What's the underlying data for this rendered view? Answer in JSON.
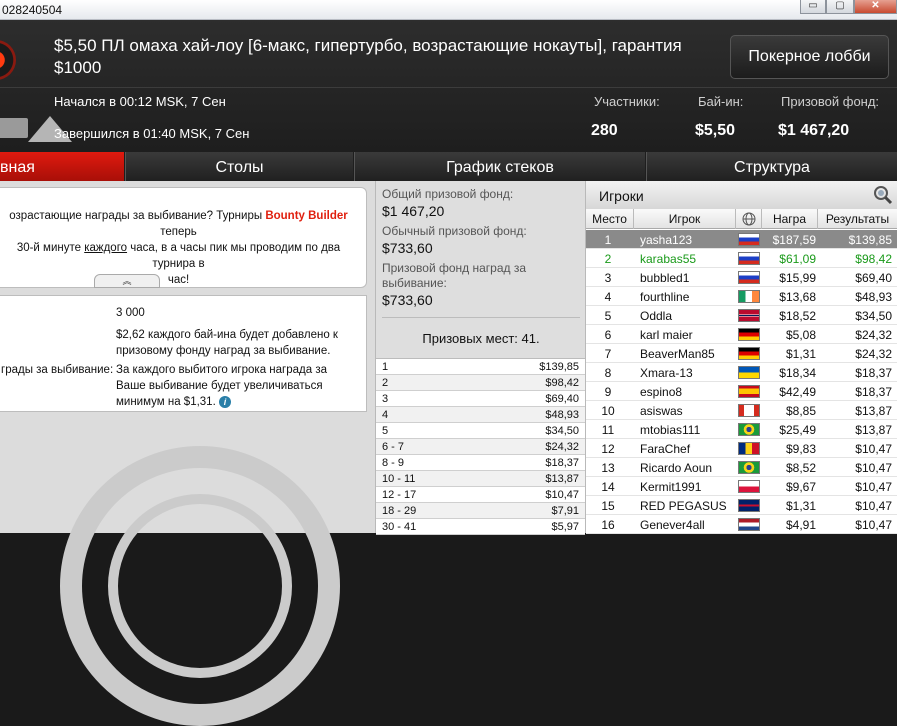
{
  "window": {
    "title_partial": "028240504",
    "btn_minimize": "▭",
    "btn_restore": "▢",
    "btn_close": "✕"
  },
  "header": {
    "title": "$5,50 ПЛ омаха хай-лоу [6-макс, гипертурбо, возрастающие нокауты], гарантия $1000",
    "lobby_button": "Покерное лобби",
    "started": "Начался в 00:12 MSK, 7 Сен",
    "finished": "Завершился в 01:40 MSK, 7 Сен",
    "stats": [
      {
        "label": "Участники:",
        "value": "280"
      },
      {
        "label": "Бай-ин:",
        "value": "$5,50"
      },
      {
        "label": "Призовой фонд:",
        "value": "$1 467,20"
      }
    ]
  },
  "tabs": [
    "вная",
    "Столы",
    "График стеков",
    "Структура"
  ],
  "notice": {
    "line1_a": "озрастающие награды за выбивание? Турниры ",
    "line1_bold": "Bounty Builder",
    "line1_b": " теперь",
    "line2_a": "30-й минуте ",
    "line2_u": "каждого",
    "line2_b": " часа, в а часы пик мы проводим по два турнира в",
    "line3": "час!",
    "collapse": "︽"
  },
  "details": {
    "starting_stack": "3 000",
    "bounty_info": "$2,62 каждого бай-ина будет добавлено к призовому фонду наград за выбивание.",
    "bounty_label": "грады за выбивание:",
    "bounty_desc": "За каждого выбитого игрока награда за Ваше выбивание будет увеличиваться минимум на $1,31."
  },
  "prize": {
    "total_label": "Общий призовой фонд:",
    "total_value": "$1 467,20",
    "regular_label": "Обычный призовой фонд:",
    "regular_value": "$733,60",
    "bounty_label": "Призовой фонд наград за выбивание:",
    "bounty_value": "$733,60",
    "places_text": "Призовых мест: 41.",
    "rows": [
      {
        "place": "1",
        "amount": "$139,85"
      },
      {
        "place": "2",
        "amount": "$98,42"
      },
      {
        "place": "3",
        "amount": "$69,40"
      },
      {
        "place": "4",
        "amount": "$48,93"
      },
      {
        "place": "5",
        "amount": "$34,50"
      },
      {
        "place": "6 - 7",
        "amount": "$24,32"
      },
      {
        "place": "8 - 9",
        "amount": "$18,37"
      },
      {
        "place": "10 - 11",
        "amount": "$13,87"
      },
      {
        "place": "12 - 17",
        "amount": "$10,47"
      },
      {
        "place": "18 - 29",
        "amount": "$7,91"
      },
      {
        "place": "30 - 41",
        "amount": "$5,97"
      }
    ]
  },
  "players": {
    "title": "Игроки",
    "columns": [
      "Место",
      "Игрок",
      "",
      "Награ",
      "Результаты"
    ],
    "rows": [
      {
        "place": "1",
        "name": "yasha123",
        "flag": "russia",
        "bounty": "$187,59",
        "result": "$139,85"
      },
      {
        "place": "2",
        "name": "karabas55",
        "flag": "russia",
        "bounty": "$61,09",
        "result": "$98,42"
      },
      {
        "place": "3",
        "name": "bubbled1",
        "flag": "russia",
        "bounty": "$15,99",
        "result": "$69,40"
      },
      {
        "place": "4",
        "name": "fourthline",
        "flag": "ireland",
        "bounty": "$13,68",
        "result": "$48,93"
      },
      {
        "place": "5",
        "name": "Oddla",
        "flag": "norway",
        "bounty": "$18,52",
        "result": "$34,50"
      },
      {
        "place": "6",
        "name": "karl maier",
        "flag": "germany",
        "bounty": "$5,08",
        "result": "$24,32"
      },
      {
        "place": "7",
        "name": "BeaverMan85",
        "flag": "germany",
        "bounty": "$1,31",
        "result": "$24,32"
      },
      {
        "place": "8",
        "name": "Xmara-13",
        "flag": "ukraine",
        "bounty": "$18,34",
        "result": "$18,37"
      },
      {
        "place": "9",
        "name": "espino8",
        "flag": "spain",
        "bounty": "$42,49",
        "result": "$18,37"
      },
      {
        "place": "10",
        "name": "asiswas",
        "flag": "canada",
        "bounty": "$8,85",
        "result": "$13,87"
      },
      {
        "place": "11",
        "name": "mtobias111",
        "flag": "brazil",
        "bounty": "$25,49",
        "result": "$13,87"
      },
      {
        "place": "12",
        "name": "FaraChef",
        "flag": "romania",
        "bounty": "$9,83",
        "result": "$10,47"
      },
      {
        "place": "13",
        "name": "Ricardo Aoun",
        "flag": "brazil",
        "bounty": "$8,52",
        "result": "$10,47"
      },
      {
        "place": "14",
        "name": "Kermit1991",
        "flag": "poland",
        "bounty": "$9,67",
        "result": "$10,47"
      },
      {
        "place": "15",
        "name": "RED PEGASUS",
        "flag": "uk",
        "bounty": "$1,31",
        "result": "$10,47"
      },
      {
        "place": "16",
        "name": "Genever4all",
        "flag": "netherlands",
        "bounty": "$4,91",
        "result": "$10,47"
      }
    ]
  }
}
